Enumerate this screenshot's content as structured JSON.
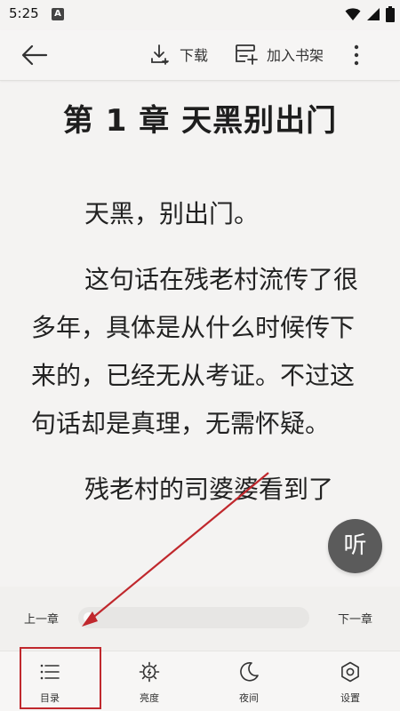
{
  "status_bar": {
    "time": "5:25",
    "app_badge": "A",
    "icons": [
      "wifi-icon",
      "signal-icon",
      "battery-icon"
    ]
  },
  "toolbar": {
    "back_icon": "arrow-left-icon",
    "download_label": "下载",
    "download_icon": "download-icon",
    "add_shelf_label": "加入书架",
    "add_shelf_icon": "add-to-shelf-icon",
    "more_icon": "more-vert-icon"
  },
  "reader": {
    "chapter_title": "第 1 章 天黑别出门",
    "paragraphs": [
      "天黑，别出门。",
      "这句话在残老村流传了很多年，具体是从什么时候传下来的，已经无从考证。不过这句话却是真理，无需怀疑。",
      "残老村的司婆婆看到了"
    ]
  },
  "listen_button": {
    "label": "听"
  },
  "progress": {
    "prev_label": "上一章",
    "next_label": "下一章",
    "value_fraction": 0.0
  },
  "bottom_nav": {
    "items": [
      {
        "label": "目录",
        "icon": "list-icon"
      },
      {
        "label": "亮度",
        "icon": "brightness-icon"
      },
      {
        "label": "夜间",
        "icon": "moon-icon"
      },
      {
        "label": "设置",
        "icon": "settings-icon"
      }
    ]
  },
  "colors": {
    "background": "#f4f3f2",
    "text": "#222222",
    "annotation": "#c0282d",
    "listen_button": "#5b5b5b"
  }
}
